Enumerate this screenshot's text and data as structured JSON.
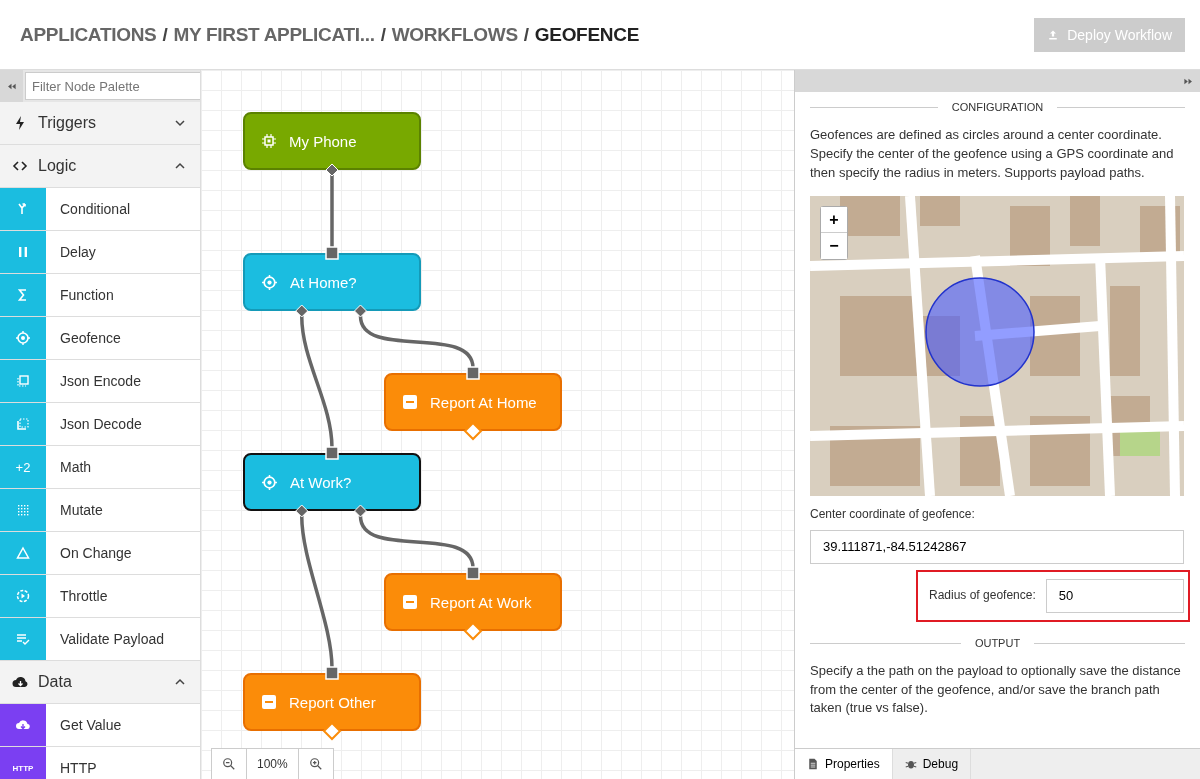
{
  "breadcrumb": [
    {
      "label": "APPLICATIONS",
      "selected": false
    },
    {
      "label": "MY FIRST APPLICATI...",
      "selected": false
    },
    {
      "label": "WORKFLOWS",
      "selected": false
    },
    {
      "label": "GEOFENCE",
      "selected": true
    }
  ],
  "separator": "/",
  "deploy_button": {
    "label": "Deploy Workflow",
    "disabled": true
  },
  "palette": {
    "filter_placeholder": "Filter Node Palette",
    "sections": [
      {
        "title": "Triggers",
        "expanded": false
      },
      {
        "title": "Logic",
        "expanded": true,
        "color": "#1bbde0",
        "items": [
          {
            "label": "Conditional"
          },
          {
            "label": "Delay"
          },
          {
            "label": "Function"
          },
          {
            "label": "Geofence"
          },
          {
            "label": "Json Encode"
          },
          {
            "label": "Json Decode"
          },
          {
            "label": "Math",
            "badge": "+2"
          },
          {
            "label": "Mutate"
          },
          {
            "label": "On Change"
          },
          {
            "label": "Throttle"
          },
          {
            "label": "Validate Payload"
          }
        ]
      },
      {
        "title": "Data",
        "expanded": true,
        "color": "#7b3ff2",
        "items": [
          {
            "label": "Get Value"
          },
          {
            "label": "HTTP",
            "badge": "HTTP"
          }
        ]
      }
    ]
  },
  "canvas": {
    "nodes": [
      {
        "label": "My Phone",
        "kind": "device",
        "selected": false
      },
      {
        "label": "At Home?",
        "kind": "geofence",
        "selected": false
      },
      {
        "label": "Report At Home",
        "kind": "debug",
        "selected": false
      },
      {
        "label": "At Work?",
        "kind": "geofence",
        "selected": true
      },
      {
        "label": "Report At Work",
        "kind": "debug",
        "selected": false
      },
      {
        "label": "Report Other",
        "kind": "debug",
        "selected": false
      }
    ],
    "zoom": "100%"
  },
  "panel": {
    "configuration_heading": "CONFIGURATION",
    "description": "Geofences are defined as circles around a center coordinate. Specify the center of the geofence using a GPS coordinate and then specify the radius in meters. Supports payload paths.",
    "map_zoom_in": "+",
    "map_zoom_out": "−",
    "center_label": "Center coordinate of geofence:",
    "center_value": "39.111871,-84.51242867",
    "radius_label": "Radius of geofence:",
    "radius_value": "50",
    "output_heading": "OUTPUT",
    "output_description": "Specify a the path on the payload to optionally save the distance from the center of the geofence, and/or save the branch path taken (true vs false).",
    "tabs": [
      {
        "label": "Properties",
        "selected": true
      },
      {
        "label": "Debug",
        "selected": false
      }
    ]
  }
}
